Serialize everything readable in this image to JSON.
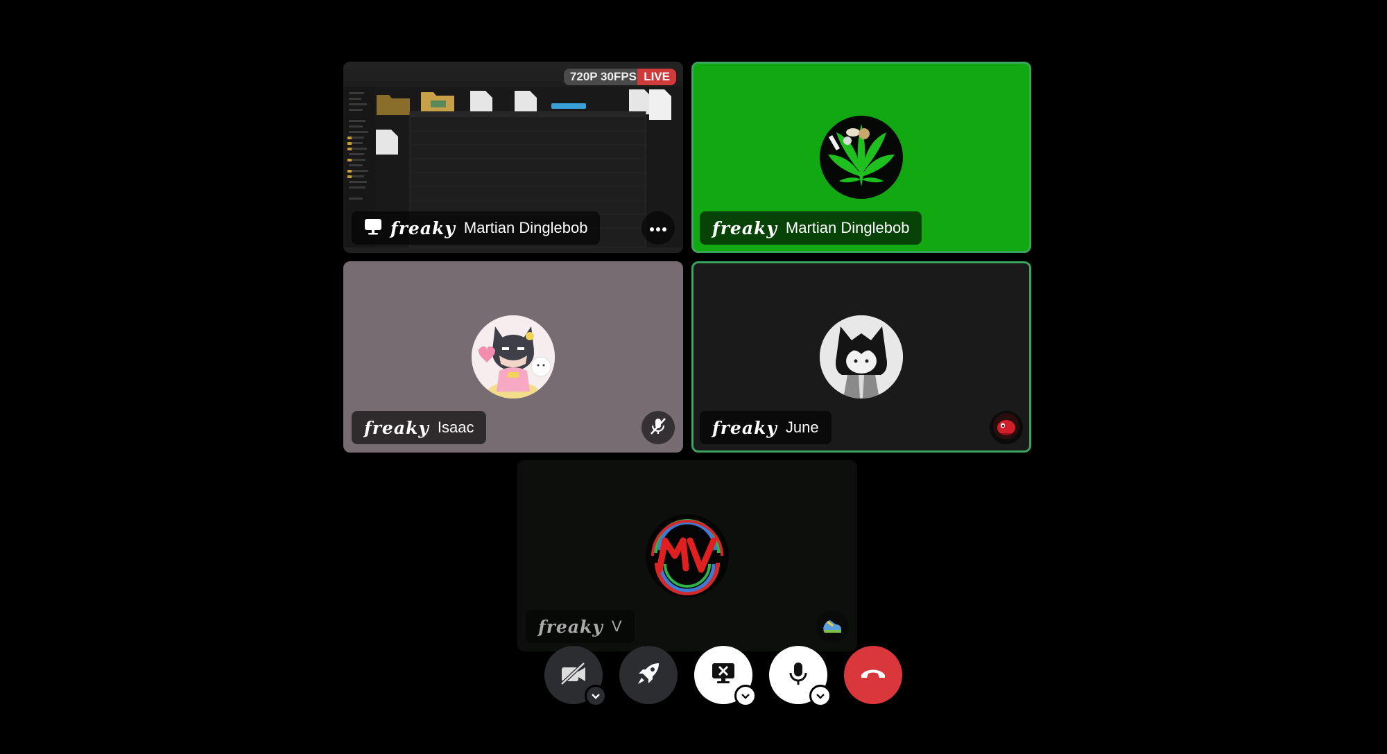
{
  "tiles": [
    {
      "tag": "𝒇𝒓𝒆𝒂𝒌𝒚",
      "name": "Martian Dinglebob",
      "type": "screenshare",
      "quality": "720P 30FPS",
      "live": "LIVE"
    },
    {
      "tag": "𝒇𝒓𝒆𝒂𝒌𝒚",
      "name": "Martian Dinglebob",
      "type": "camera-avatar",
      "background": "#12a812",
      "speaking": true
    },
    {
      "tag": "𝒇𝒓𝒆𝒂𝒌𝒚",
      "name": "Isaac",
      "type": "avatar",
      "background": "#776c72",
      "muted": true
    },
    {
      "tag": "𝒇𝒓𝒆𝒂𝒌𝒚",
      "name": "June",
      "type": "avatar",
      "background": "#1a1a1b",
      "speaking": true
    },
    {
      "tag": "𝒇𝒓𝒆𝒂𝒌𝒚",
      "name": "V",
      "type": "avatar",
      "background": "#0d0f0d"
    }
  ],
  "controls": [
    {
      "name": "camera-off",
      "icon": "camera-off-icon"
    },
    {
      "name": "activities",
      "icon": "rocket-icon"
    },
    {
      "name": "stop-screenshare",
      "icon": "screen-x-icon"
    },
    {
      "name": "microphone",
      "icon": "microphone-icon"
    },
    {
      "name": "disconnect",
      "icon": "phone-hangup-icon"
    }
  ],
  "colors": {
    "speaking": "#3ba55d",
    "live": "#d03a3a",
    "disconnect": "#da373c"
  }
}
